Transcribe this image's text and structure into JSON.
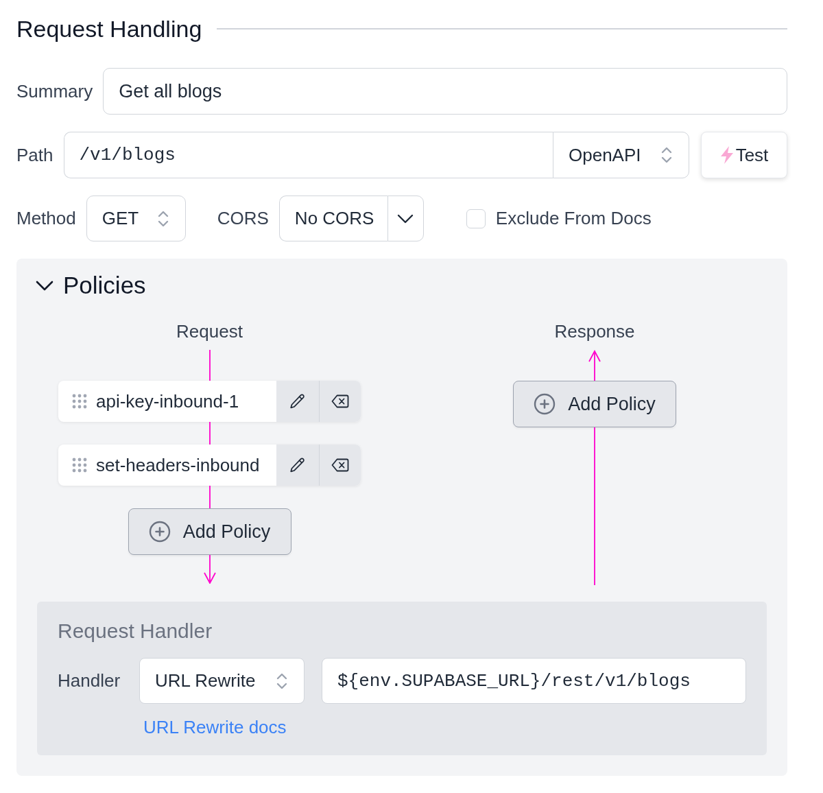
{
  "section": {
    "title": "Request Handling"
  },
  "summary": {
    "label": "Summary",
    "value": "Get all blogs"
  },
  "path": {
    "label": "Path",
    "value": "/v1/blogs",
    "spec": "OpenAPI",
    "test_button": "Test"
  },
  "method": {
    "label": "Method",
    "value": "GET"
  },
  "cors": {
    "label": "CORS",
    "value": "No CORS"
  },
  "exclude_from_docs": {
    "label": "Exclude From Docs",
    "checked": false
  },
  "policies": {
    "title": "Policies",
    "expanded": true,
    "columns": [
      {
        "kind": "request",
        "label": "Request",
        "items": [
          {
            "name": "api-key-inbound-1"
          },
          {
            "name": "set-headers-inbound"
          }
        ],
        "add_button": "Add Policy"
      },
      {
        "kind": "response",
        "label": "Response",
        "add_button": "Add Policy"
      }
    ]
  },
  "request_handler": {
    "title": "Request Handler",
    "handler_label": "Handler",
    "handler": "URL Rewrite",
    "url": "${env.SUPABASE_URL}/rest/v1/blogs",
    "docs_link": "URL Rewrite docs"
  }
}
